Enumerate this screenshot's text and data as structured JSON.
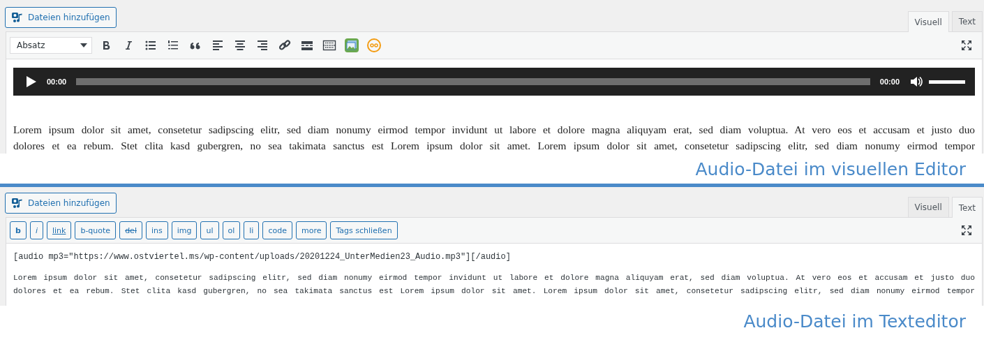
{
  "visual_editor": {
    "add_media_button": "Dateien hinzufügen",
    "tabs": [
      {
        "label": "Visuell",
        "selected": true
      },
      {
        "label": "Text",
        "selected": false
      }
    ],
    "format_select": "Absatz",
    "toolbar": [
      {
        "kind": "bold"
      },
      {
        "kind": "italic"
      },
      {
        "kind": "bullets"
      },
      {
        "kind": "numbers"
      },
      {
        "kind": "quote"
      },
      {
        "kind": "alignleft"
      },
      {
        "kind": "aligncenter"
      },
      {
        "kind": "alignright"
      },
      {
        "kind": "link"
      },
      {
        "kind": "more"
      },
      {
        "kind": "toolbar"
      },
      {
        "kind": "photo"
      },
      {
        "kind": "plugin"
      }
    ],
    "audio_player": {
      "elapsed": "00:00",
      "duration": "00:00",
      "volume": {
        "level": 1
      }
    },
    "paragraph_lines": [
      "Lorem ipsum dolor sit amet, consetetur sadipscing elitr, sed diam nonumy eirmod tempor invidunt ut labore et dolore magna aliquyam erat, sed diam voluptua. At vero eos et accusam et justo duo",
      "dolores et ea rebum. Stet clita kasd gubergren, no sea takimata sanctus est Lorem ipsum dolor sit amet. Lorem ipsum dolor sit amet, consetetur sadipscing elitr, sed diam nonumy eirmod tempor"
    ],
    "caption": "Audio-Datei im visuellen Editor"
  },
  "text_editor": {
    "add_media_button": "Dateien hinzufügen",
    "tabs": [
      {
        "label": "Visuell",
        "selected": false
      },
      {
        "label": "Text",
        "selected": true
      }
    ],
    "quicktags": [
      {
        "label": "b",
        "kind": "bold"
      },
      {
        "label": "i",
        "kind": "italic"
      },
      {
        "label": "link",
        "kind": "underline"
      },
      {
        "label": "b-quote",
        "kind": "plain"
      },
      {
        "label": "del",
        "kind": "strike"
      },
      {
        "label": "ins",
        "kind": "plain"
      },
      {
        "label": "img",
        "kind": "plain"
      },
      {
        "label": "ul",
        "kind": "plain"
      },
      {
        "label": "ol",
        "kind": "plain"
      },
      {
        "label": "li",
        "kind": "plain"
      },
      {
        "label": "code",
        "kind": "plain"
      },
      {
        "label": "more",
        "kind": "plain"
      },
      {
        "label": "Tags schließen",
        "kind": "plain"
      }
    ],
    "shortcode": "[audio mp3=\"https://www.ostviertel.ms/wp-content/uploads/20201224_UnterMedien23_Audio.mp3\"][/audio]",
    "paragraph_lines": [
      "Lorem ipsum dolor sit amet, consetetur sadipscing elitr, sed diam nonumy eirmod tempor invidunt ut labore et dolore magna aliquyam erat, sed diam voluptua. At vero eos et accusam et justo duo",
      "dolores et ea rebum. Stet clita kasd gubergren, no sea takimata sanctus est Lorem ipsum dolor sit amet. Lorem ipsum dolor sit amet, consetetur sadipscing elitr, sed diam nonumy eirmod tempor"
    ],
    "caption": "Audio-Datei im Texteditor"
  }
}
